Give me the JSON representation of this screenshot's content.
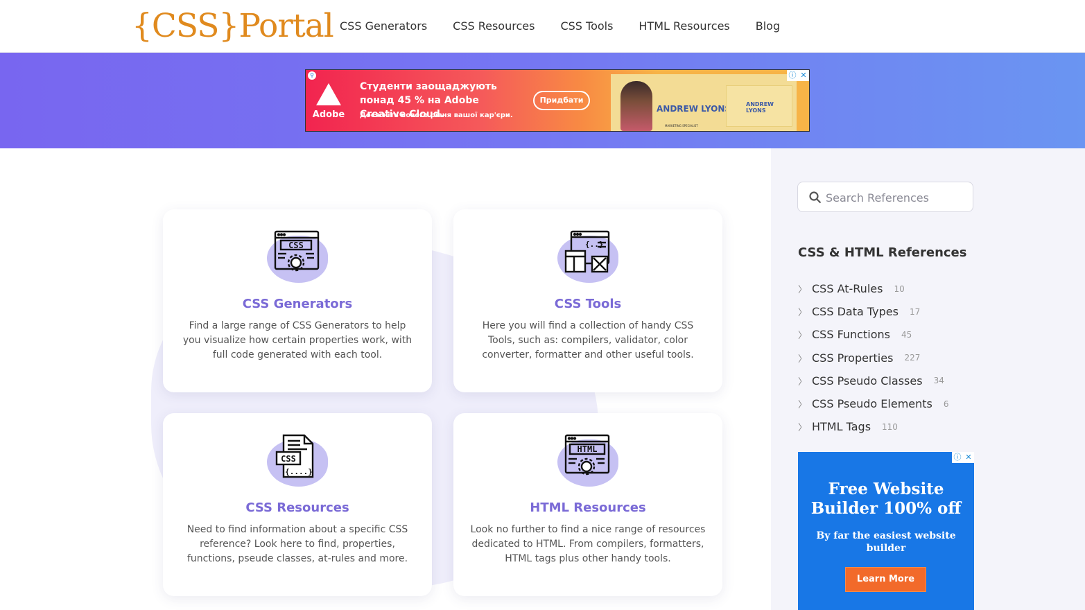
{
  "header": {
    "logo": "{CSS}Portal",
    "nav": [
      "CSS Generators",
      "CSS Resources",
      "CSS Tools",
      "HTML Resources",
      "Blog"
    ]
  },
  "ad_top": {
    "brand": "Adobe",
    "headline": "Студенти заощаджують понад 45 % на Adobe Creative Cloud.",
    "subline": "Досягніть нового рівня вашої кар'єри.",
    "button": "Придбати",
    "person_name": "ANDREW LYONS",
    "person_title": "MARKETING SPECIALIST",
    "card_name": "ANDREW LYONS"
  },
  "cards": [
    {
      "title": "CSS Generators",
      "text": "Find a large range of CSS Generators to help you visualize how certain properties work, with full code generated with each tool.",
      "icon": "css-generator-icon"
    },
    {
      "title": "CSS Tools",
      "text": "Here you will find a collection of handy CSS Tools, such as: compilers, validator, color converter, formatter and other useful tools.",
      "icon": "css-tools-icon"
    },
    {
      "title": "CSS Resources",
      "text": "Need to find information about a specific CSS reference? Look here to find, properties, functions, pseude classes, at-rules and more.",
      "icon": "css-resources-icon"
    },
    {
      "title": "HTML Resources",
      "text": "Look no further to find a nice range of resources dedicated to HTML. From compilers, formatters, HTML tags plus other handy tools.",
      "icon": "html-resources-icon"
    }
  ],
  "sidebar": {
    "search_placeholder": "Search References",
    "ref_title": "CSS & HTML References",
    "refs": [
      {
        "label": "CSS At-Rules",
        "count": "10"
      },
      {
        "label": "CSS Data Types",
        "count": "17"
      },
      {
        "label": "CSS Functions",
        "count": "45"
      },
      {
        "label": "CSS Properties",
        "count": "227"
      },
      {
        "label": "CSS Pseudo Classes",
        "count": "34"
      },
      {
        "label": "CSS Pseudo Elements",
        "count": "6"
      },
      {
        "label": "HTML Tags",
        "count": "110"
      }
    ],
    "ad": {
      "title": "Free Website Builder 100% off",
      "subtitle": "By far the easiest website builder",
      "button": "Learn More"
    }
  },
  "colors": {
    "logo": "#e08a1e",
    "accent": "#7a6ad6",
    "banner_start": "#7866f0",
    "banner_end": "#6a95f2",
    "ad_blue": "#1877e6",
    "ad_orange": "#f26a2a"
  }
}
